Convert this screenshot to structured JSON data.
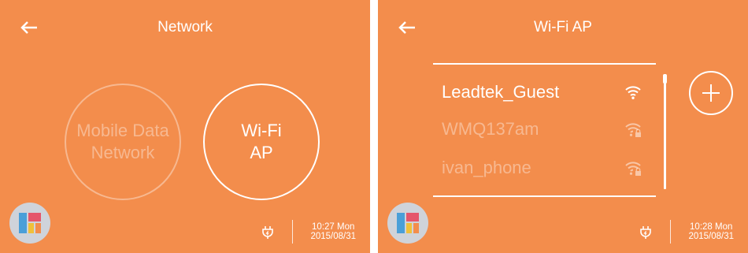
{
  "left": {
    "title": "Network",
    "options": [
      {
        "label": "Mobile Data\nNetwork",
        "line1": "Mobile Data",
        "line2": "Network",
        "state": "disabled"
      },
      {
        "label": "Wi-Fi\nAP",
        "line1": "Wi-Fi",
        "line2": "AP",
        "state": "enabled"
      }
    ],
    "status": {
      "time_day": "10:27 Mon",
      "date": "2015/08/31"
    }
  },
  "right": {
    "title": "Wi-Fi AP",
    "networks": [
      {
        "ssid": "Leadtek_Guest",
        "secured": false,
        "active": true
      },
      {
        "ssid": "WMQ137am",
        "secured": true,
        "active": false
      },
      {
        "ssid": "ivan_phone",
        "secured": true,
        "active": false
      }
    ],
    "status": {
      "time_day": "10:28 Mon",
      "date": "2015/08/31"
    }
  },
  "icons": {
    "back": "arrow-left-icon",
    "add": "plus-icon",
    "app": "apps-grid-icon",
    "power": "power-plug-icon",
    "wifi": "wifi-signal-icon",
    "lock": "lock-icon"
  },
  "colors": {
    "background": "#f38d4c",
    "foreground": "#ffffff",
    "dimmed": "rgba(255,255,255,0.38)"
  }
}
